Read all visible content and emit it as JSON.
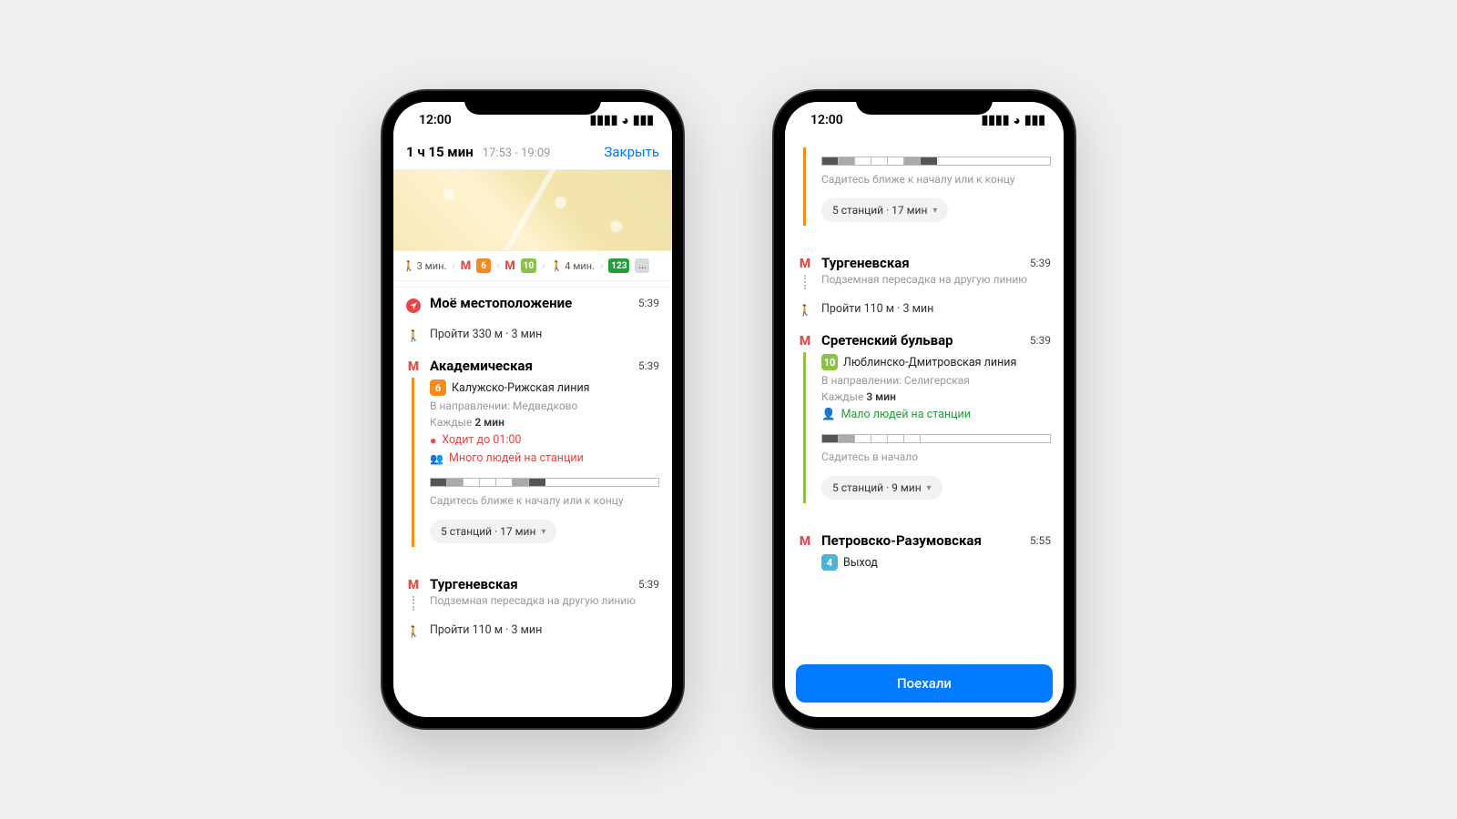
{
  "status": {
    "time": "12:00"
  },
  "p1": {
    "header": {
      "duration": "1 ч 15 мин",
      "range": "17:53 - 19:09",
      "close": "Закрыть"
    },
    "segbar": {
      "walk1": "3 мин.",
      "walk2": "4 мин.",
      "line6": "6",
      "line10": "10",
      "bus": "123",
      "more": "..."
    },
    "s1": {
      "title": "Моё местоположение",
      "time": "5:39"
    },
    "w1": "Пройти 330 м · 3 мин",
    "s2": {
      "title": "Академическая",
      "time": "5:39",
      "lineNum": "6",
      "lineName": "Калужско-Рижская линия",
      "dir": "В направлении: Медведково",
      "freqPrefix": "Каждые ",
      "freqVal": "2 мин",
      "untilLabel": "Ходит до 01:00",
      "crowd": "Много людей на станции",
      "trainHint": "Садитесь ближе к началу или к концу",
      "stops": "5 станций · 17 мин"
    },
    "s3": {
      "title": "Тургеневская",
      "time": "5:39",
      "sub": "Подземная пересадка на другую линию"
    },
    "w2": "Пройти 110 м · 3 мин"
  },
  "p2": {
    "top": {
      "trainHint": "Садитесь ближе к началу или к концу",
      "stops": "5 станций · 17 мин"
    },
    "s1": {
      "title": "Тургеневская",
      "time": "5:39",
      "sub": "Подземная пересадка на другую линию"
    },
    "w1": "Пройти 110 м · 3 мин",
    "s2": {
      "title": "Сретенский бульвар",
      "time": "5:39",
      "lineNum": "10",
      "lineName": "Люблинско-Дмитровская линия",
      "dir": "В направлении: Селигерская",
      "freqPrefix": "Каждые ",
      "freqVal": "3 мин",
      "crowd": "Мало людей на станции",
      "trainHint": "Садитесь в начало",
      "stops": "5 станций · 9 мин"
    },
    "s3": {
      "title": "Петровско-Разумовская",
      "time": "5:55",
      "exitNum": "4",
      "exitLabel": "Выход"
    },
    "go": "Поехали"
  }
}
